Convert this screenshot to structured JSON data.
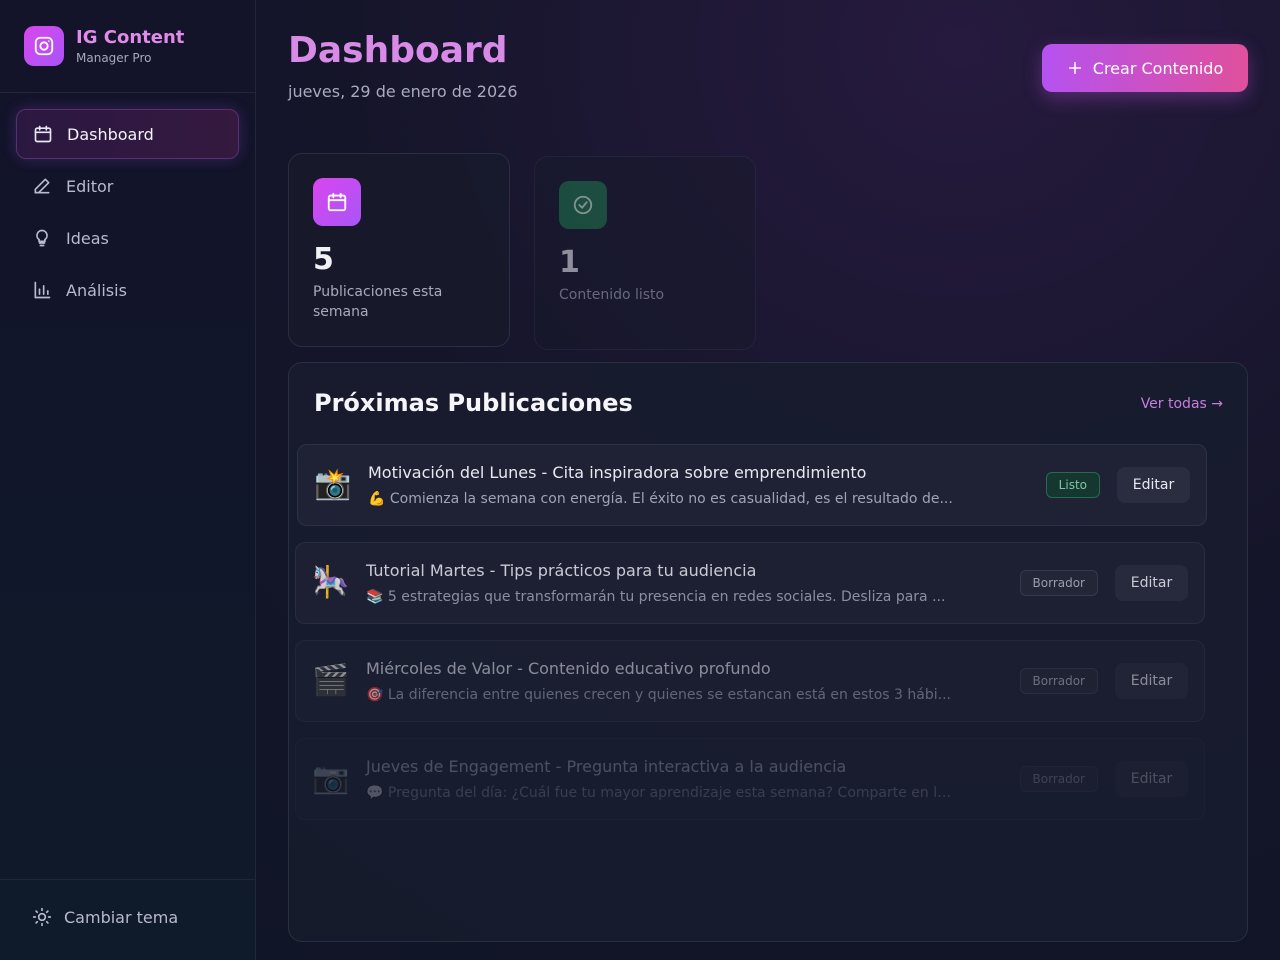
{
  "brand": {
    "name": "IG Content",
    "subtitle": "Manager Pro"
  },
  "sidebar": {
    "items": [
      {
        "label": "Dashboard",
        "icon": "calendar-icon",
        "active": true
      },
      {
        "label": "Editor",
        "icon": "pencil-icon"
      },
      {
        "label": "Ideas",
        "icon": "lightbulb-icon"
      },
      {
        "label": "Análisis",
        "icon": "bar-chart-icon"
      }
    ],
    "theme_toggle": "Cambiar tema"
  },
  "header": {
    "title": "Dashboard",
    "date": "jueves, 29 de enero de 2026",
    "create_button": "Crear Contenido"
  },
  "stats": [
    {
      "value": "5",
      "label": "Publicaciones esta semana",
      "icon": "calendar-icon"
    },
    {
      "value": "1",
      "label": "Contenido listo",
      "icon": "check-circle-icon"
    }
  ],
  "upcoming": {
    "title": "Próximas Publicaciones",
    "view_all": "Ver todas →",
    "edit_label": "Editar",
    "posts": [
      {
        "thumb": "📸",
        "title": "Motivación del Lunes - Cita inspiradora sobre emprendimiento",
        "excerpt": "💪 Comienza la semana con energía. El éxito no es casualidad, es el resultado de...",
        "status": "Listo"
      },
      {
        "thumb": "🎠",
        "title": "Tutorial Martes - Tips prácticos para tu audiencia",
        "excerpt": "📚 5 estrategias que transformarán tu presencia en redes sociales. Desliza para ...",
        "status": "Borrador"
      },
      {
        "thumb": "🎬",
        "title": "Miércoles de Valor - Contenido educativo profundo",
        "excerpt": "🎯 La diferencia entre quienes crecen y quienes se estancan está en estos 3 hábi...",
        "status": "Borrador"
      },
      {
        "thumb": "📷",
        "title": "Jueves de Engagement - Pregunta interactiva a la audiencia",
        "excerpt": "💬 Pregunta del día: ¿Cuál fue tu mayor aprendizaje esta semana? Comparte en los...",
        "status": "Borrador"
      }
    ]
  },
  "colors": {
    "accent_pink": "#e0509c",
    "accent_purple": "#b552f0",
    "ready_green": "#7cc7a3",
    "background": "#15152a"
  }
}
